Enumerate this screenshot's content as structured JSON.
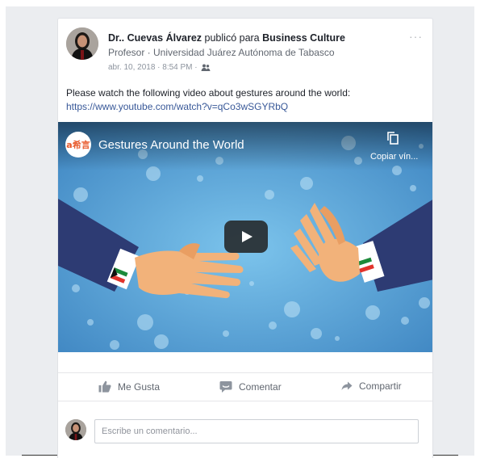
{
  "post": {
    "author": "Dr.. Cuevas Álvarez",
    "published_for": "publicó para",
    "group": "Business Culture",
    "subtitle": "Profesor · Universidad Juárez Autónoma de Tabasco",
    "date": "abr. 10, 2018 · 8:54 PM ·",
    "audience_icon": "group-icon",
    "more_icon": "more-options-icon",
    "more_glyph": "···",
    "text": "Please watch the following video about gestures around the world:",
    "link": "https://www.youtube.com/watch?v=qCo3wSGYRbQ"
  },
  "video": {
    "channel_logo_text": "a希言",
    "title": "Gestures Around the World",
    "copy_label": "Copiar vín...",
    "play_icon": "play-icon"
  },
  "actions": {
    "like": "Me Gusta",
    "comment": "Comentar",
    "share": "Compartir"
  },
  "comment_box": {
    "placeholder": "Escribe un comentario..."
  },
  "colors": {
    "link": "#385898",
    "video_blue": "#5aa8dc",
    "sleeve": "#2d3b73",
    "hand": "#f2b27a",
    "action_text": "#616770"
  }
}
